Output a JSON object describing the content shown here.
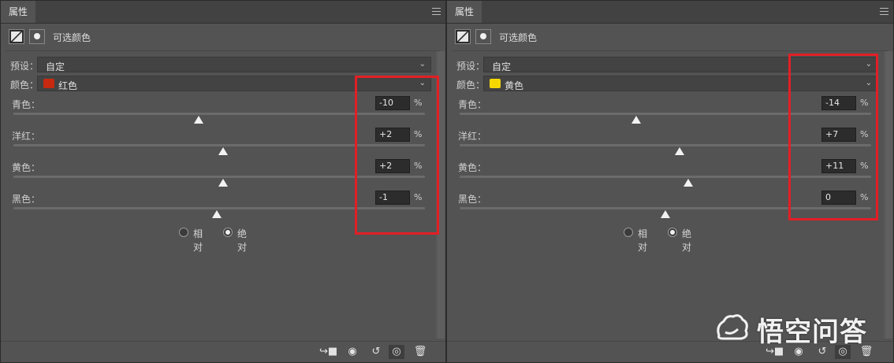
{
  "panels": [
    {
      "tab": "属性",
      "title": "可选颜色",
      "preset_label": "预设：",
      "preset_value": "自定",
      "color_label": "颜色：",
      "color_value": "红色",
      "swatch_color": "#c8290f",
      "sliders": [
        {
          "label": "青色：",
          "value": "-10",
          "unit": "%",
          "level": -10
        },
        {
          "label": "洋红：",
          "value": "+2",
          "unit": "%",
          "level": 2
        },
        {
          "label": "黄色：",
          "value": "+2",
          "unit": "%",
          "level": 2
        },
        {
          "label": "黑色：",
          "value": "-1",
          "unit": "%",
          "level": -1
        }
      ],
      "radio_relative": "相对",
      "radio_absolute": "绝对",
      "selected_mode": "absolute"
    },
    {
      "tab": "属性",
      "title": "可选颜色",
      "preset_label": "预设：",
      "preset_value": "自定",
      "color_label": "颜色：",
      "color_value": "黄色",
      "swatch_color": "#f5d800",
      "sliders": [
        {
          "label": "青色：",
          "value": "-14",
          "unit": "%",
          "level": -14
        },
        {
          "label": "洋红：",
          "value": "+7",
          "unit": "%",
          "level": 7
        },
        {
          "label": "黄色：",
          "value": "+11",
          "unit": "%",
          "level": 11
        },
        {
          "label": "黑色：",
          "value": "0",
          "unit": "%",
          "level": 0
        }
      ],
      "radio_relative": "相对",
      "radio_absolute": "绝对",
      "selected_mode": "absolute"
    }
  ],
  "bottom_icons": [
    "clip-to-layer-icon",
    "view-previous-icon",
    "reset-icon",
    "visibility-eye-icon",
    "trash-icon"
  ],
  "highlight_color": "#e21f26",
  "watermark": {
    "text": "悟空问答"
  }
}
